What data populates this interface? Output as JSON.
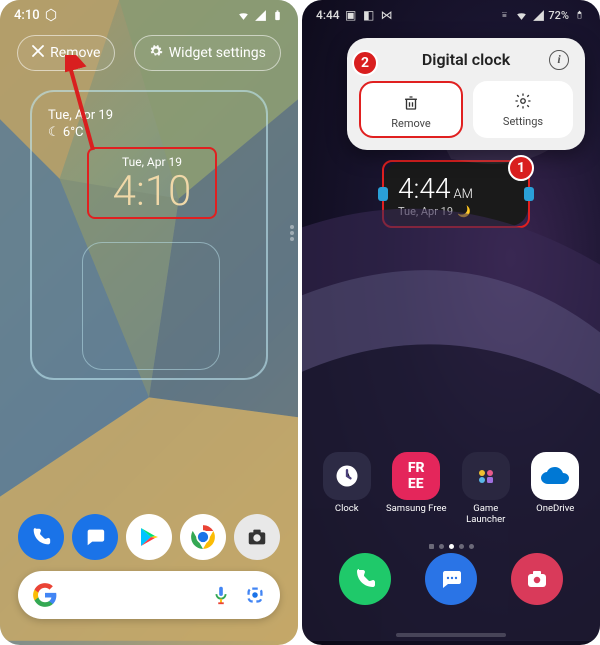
{
  "left": {
    "status": {
      "time": "4:10",
      "battery": "full",
      "signal": "full"
    },
    "actions": {
      "remove": {
        "label": "Remove",
        "icon": "close-icon"
      },
      "settings": {
        "label": "Widget settings",
        "icon": "gear-icon"
      }
    },
    "widget": {
      "weather": {
        "date_line": "Tue, Apr 19",
        "temp": "6°C",
        "icon": "moon-icon"
      },
      "clock": {
        "date": "Tue, Apr 19",
        "time": "4:10"
      }
    },
    "dock": [
      {
        "name": "phone",
        "color": "#1a73e8",
        "glyph": "phone-icon"
      },
      {
        "name": "messages",
        "color": "#1a73e8",
        "glyph": "chat-icon"
      },
      {
        "name": "play-store",
        "color": "#ffffff",
        "glyph": "play-icon"
      },
      {
        "name": "chrome",
        "color": "#ffffff",
        "glyph": "chrome-icon"
      },
      {
        "name": "camera",
        "color": "#f0f0f0",
        "glyph": "camera-icon"
      }
    ],
    "search": {
      "placeholder": "",
      "mic": "mic-icon",
      "lens": "lens-icon"
    }
  },
  "right": {
    "status": {
      "time": "4:44",
      "battery_text": "72%",
      "signal": "full"
    },
    "popup": {
      "title": "Digital clock",
      "info": "i",
      "actions": [
        {
          "name": "remove",
          "label": "Remove",
          "icon": "trash-icon",
          "highlighted": true
        },
        {
          "name": "settings",
          "label": "Settings",
          "icon": "gear-icon",
          "highlighted": false
        }
      ]
    },
    "badges": {
      "one": "1",
      "two": "2"
    },
    "widget": {
      "time": "4:44",
      "ampm": "AM",
      "date": "Tue, Apr 19",
      "icon": "moon-icon"
    },
    "apps_row": [
      {
        "label": "Clock",
        "bg": "#2d2b45",
        "icon": "clock-icon"
      },
      {
        "label": "Samsung Free",
        "bg": "#e4265b",
        "icon": "free-text-icon"
      },
      {
        "label": "Game Launcher",
        "bg": "#2a2740",
        "icon": "game-icon"
      },
      {
        "label": "OneDrive",
        "bg": "#ffffff",
        "icon": "cloud-icon"
      }
    ],
    "dock": [
      {
        "name": "phone",
        "bg": "#1fc96a",
        "icon": "phone-icon"
      },
      {
        "name": "messages",
        "bg": "#2a74e6",
        "icon": "chat-icon"
      },
      {
        "name": "camera",
        "bg": "#d93a5a",
        "icon": "camera-icon"
      }
    ]
  },
  "colors": {
    "annotation_red": "#e02020",
    "samsung_handle": "#2aa0d8"
  }
}
